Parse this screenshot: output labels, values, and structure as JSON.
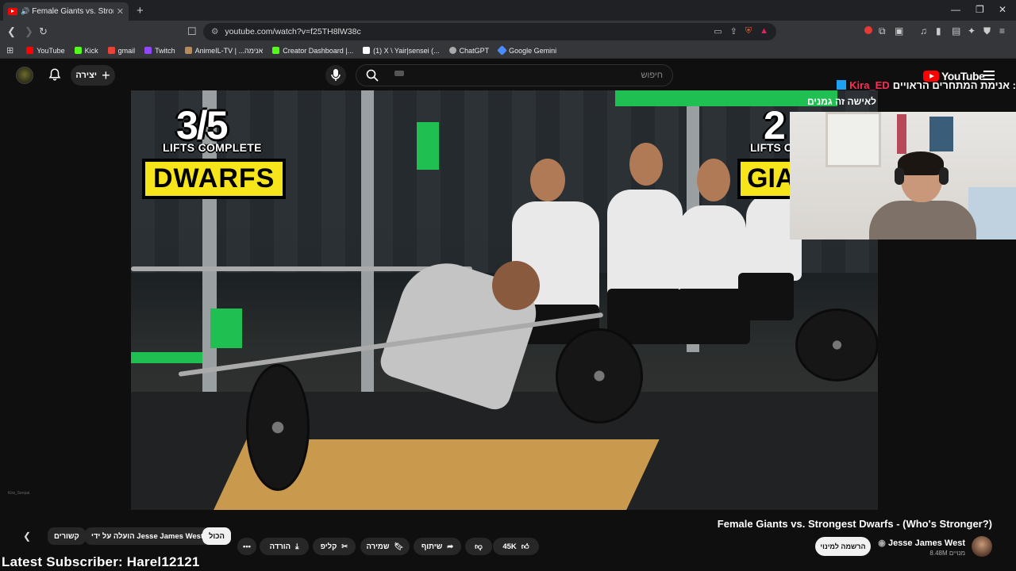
{
  "browser": {
    "tab_title": "Female Giants vs. Strongest D",
    "url": "youtube.com/watch?v=f25TH8lW38c",
    "bookmarks": [
      {
        "label": "YouTube",
        "color": "#ff0000"
      },
      {
        "label": "Kick",
        "color": "#53fc18"
      },
      {
        "label": "gmail",
        "color": "#ea4335"
      },
      {
        "label": "Twitch",
        "color": "#9146ff"
      },
      {
        "label": "AnimeIL-TV | ...אנימה",
        "color": "#b88a5a"
      },
      {
        "label": "Creator Dashboard |...",
        "color": "#53fc18"
      },
      {
        "label": "(1) X \\ Yair|sensei (...",
        "color": "#ffffff"
      },
      {
        "label": "ChatGPT",
        "color": "#aaaaaa"
      },
      {
        "label": "Google Gemini",
        "color": "#4a8cff"
      }
    ]
  },
  "youtube": {
    "create_label": "יצירה",
    "search_placeholder": "חיפוש",
    "logo_text": "YouTube"
  },
  "video_overlay": {
    "left_fraction": "3/5",
    "left_sub": "LIFTS COMPLETE",
    "left_label": "DWARFS",
    "right_fraction": "2",
    "right_sub": "LIFTS C",
    "right_label": "GIA"
  },
  "stream_overlay": {
    "title": "אנימת המתחרים הראויים :",
    "username": "Kira_ED",
    "sub_text": "לאישה זה גמנים",
    "latest_subscriber": "Latest Subscriber: Harel12121",
    "watermark": "Kira_Senpai"
  },
  "video_info": {
    "title": "Female Giants vs. Strongest Dwarfs - (Who's Stronger?)",
    "channel": "Jesse James West",
    "subscribers": "8.48M מנויים",
    "subscribe_label": "הרשמה למינוי",
    "likes": "45K",
    "share_label": "שיתוף",
    "save_label": "שמירה",
    "clip_label": "קליפ",
    "download_label": "הורדה"
  },
  "chips": {
    "all": "הכול",
    "by": "הועלה על ידי Jesse James West",
    "related": "קשורים"
  }
}
